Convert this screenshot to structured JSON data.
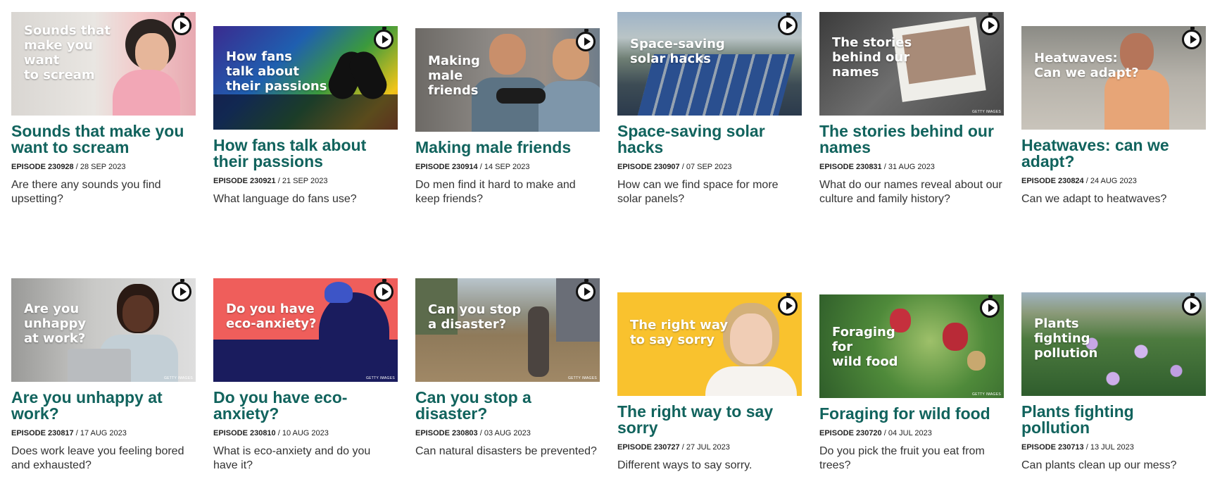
{
  "colors": {
    "title": "#11635d",
    "text": "#333333",
    "badge": "#111111"
  },
  "badge_icon": "stopwatch-play-icon",
  "episodes": [
    {
      "thumb_text": "Sounds that\nmake you want\nto scream",
      "title": "Sounds that make you want to scream",
      "episode": "EPISODE 230928",
      "date": "/ 28 SEP 2023",
      "description": "Are there any sounds you find upsetting?",
      "getty": ""
    },
    {
      "thumb_text": "How fans\ntalk about\ntheir passions",
      "title": "How fans talk about their passions",
      "episode": "EPISODE 230921",
      "date": "/ 21 SEP 2023",
      "description": "What language do fans use?",
      "getty": ""
    },
    {
      "thumb_text": "Making\nmale\nfriends",
      "title": "Making male friends",
      "episode": "EPISODE 230914",
      "date": "/ 14 SEP 2023",
      "description": "Do men find it hard to make and keep friends?",
      "getty": ""
    },
    {
      "thumb_text": "Space-saving\nsolar hacks",
      "title": "Space-saving solar hacks",
      "episode": "EPISODE 230907",
      "date": "/ 07 SEP 2023",
      "description": "How can we find space for more solar panels?",
      "getty": ""
    },
    {
      "thumb_text": "The stories\nbehind our\nnames",
      "title": "The stories behind our names",
      "episode": "EPISODE 230831",
      "date": "/ 31 AUG 2023",
      "description": "What do our names reveal about our culture and family history?",
      "getty": "GETTY IMAGES"
    },
    {
      "thumb_text": "Heatwaves:\nCan we adapt?",
      "title": "Heatwaves: can we adapt?",
      "episode": "EPISODE 230824",
      "date": "/ 24 AUG 2023",
      "description": "Can we adapt to heatwaves?",
      "getty": ""
    },
    {
      "thumb_text": "Are you\nunhappy\nat work?",
      "title": "Are you unhappy at work?",
      "episode": "EPISODE 230817",
      "date": "/ 17 AUG 2023",
      "description": "Does work leave you feeling bored and exhausted?",
      "getty": "GETTY IMAGES"
    },
    {
      "thumb_text": "Do you have\neco-anxiety?",
      "title": "Do you have eco-anxiety?",
      "episode": "EPISODE 230810",
      "date": "/ 10 AUG 2023",
      "description": "What is eco-anxiety and do you have it?",
      "getty": "GETTY IMAGES"
    },
    {
      "thumb_text": "Can you stop\na disaster?",
      "title": "Can you stop a disaster?",
      "episode": "EPISODE 230803",
      "date": "/ 03 AUG 2023",
      "description": "Can natural disasters be prevented?",
      "getty": "GETTY IMAGES"
    },
    {
      "thumb_text": "The right way\nto say sorry",
      "title": "The right way to say sorry",
      "episode": "EPISODE 230727",
      "date": "/ 27 JUL 2023",
      "description": "Different ways to say sorry.",
      "getty": ""
    },
    {
      "thumb_text": "Foraging\nfor\nwild food",
      "title": "Foraging for wild food",
      "episode": "EPISODE 230720",
      "date": "/ 04 JUL 2023",
      "description": "Do you pick the fruit you eat from trees?",
      "getty": "GETTY IMAGES"
    },
    {
      "thumb_text": "Plants\nfighting\npollution",
      "title": "Plants fighting pollution",
      "episode": "EPISODE 230713",
      "date": "/ 13 JUL 2023",
      "description": "Can plants clean up our mess?",
      "getty": ""
    }
  ]
}
